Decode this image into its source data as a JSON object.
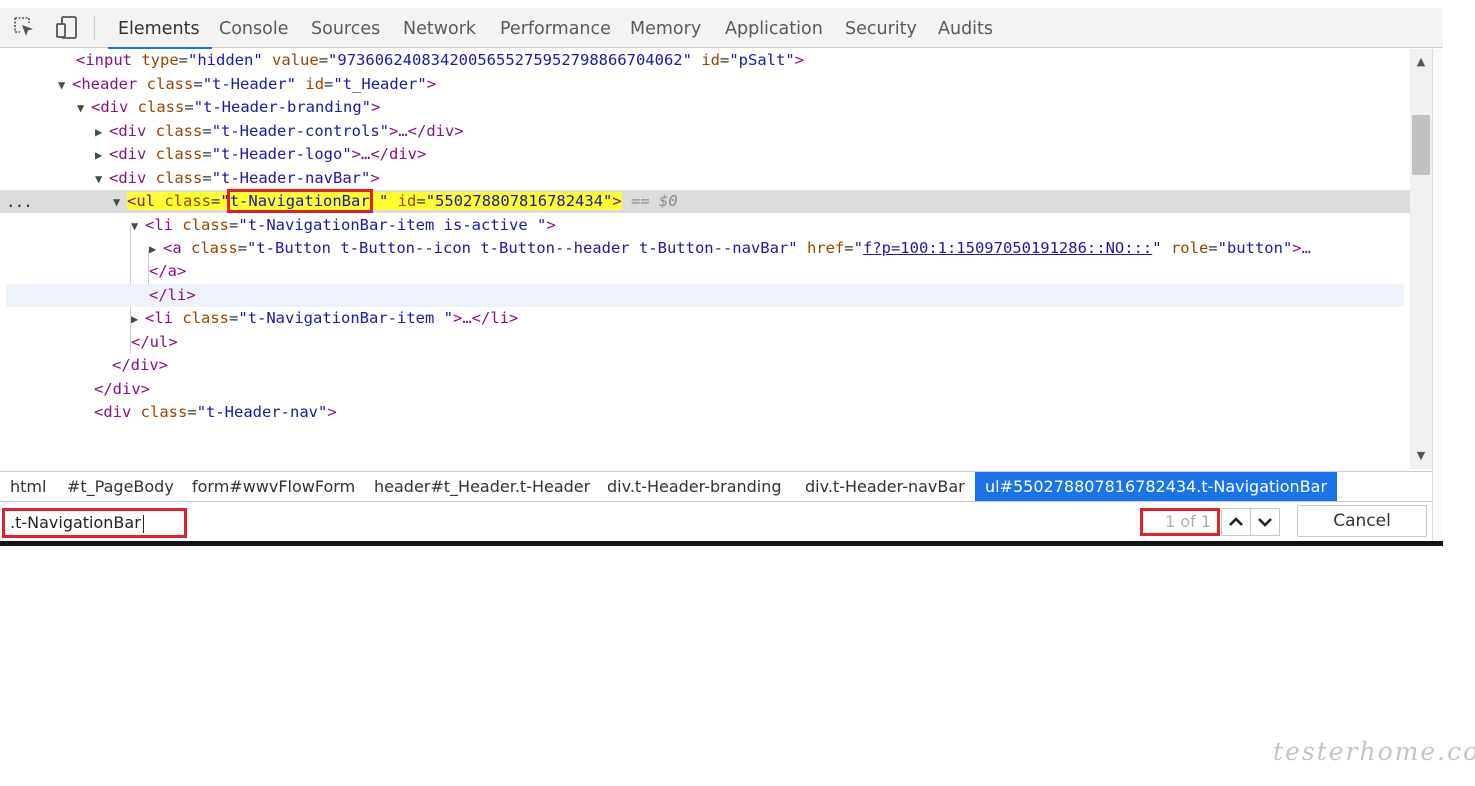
{
  "toolbar": {
    "icons": [
      "inspect-element-icon",
      "device-toolbar-icon"
    ],
    "tabs": [
      "Elements",
      "Console",
      "Sources",
      "Network",
      "Performance",
      "Memory",
      "Application",
      "Security",
      "Audits"
    ],
    "active_tab": "Elements"
  },
  "tree": {
    "r0": {
      "tag_open": "<input",
      "a1": "type",
      "v1": "\"hidden\"",
      "a2": "value",
      "v2": "\"97360624083420056552759527988667040​62\"",
      "a3": "id",
      "v3": "\"pSalt\"",
      "tag_close": ">"
    },
    "r1": {
      "tag_open": "<header",
      "a1": "class",
      "v1": "\"t-Header\"",
      "a2": "id",
      "v2": "\"t_Header\"",
      "tag_close": ">"
    },
    "r2": {
      "tag_open": "<div",
      "a1": "class",
      "v1": "\"t-Header-branding\"",
      "tag_close": ">"
    },
    "r3": {
      "tag_open": "<div",
      "a1": "class",
      "v1": "\"t-Header-controls\"",
      "tag_close": ">…</div>"
    },
    "r4": {
      "tag_open": "<div",
      "a1": "class",
      "v1": "\"t-Header-logo\"",
      "tag_close": ">…</div>"
    },
    "r5": {
      "tag_open": "<div",
      "a1": "class",
      "v1": "\"t-Header-navBar\"",
      "tag_close": ">"
    },
    "r6": {
      "tag_open": "<ul",
      "a1": "class",
      "q_open": "\"",
      "v1": "t-NavigationBar",
      "q_close": " \"",
      "a2": "id",
      "v2": "\"550278807816782434\"",
      "tag_close": ">",
      "suffix": "== $0",
      "dots": "..."
    },
    "r7": {
      "tag_open": "<li",
      "a1": "class",
      "v1": "\"t-NavigationBar-item is-active \"",
      "tag_close": ">"
    },
    "r8": {
      "tag_open": "<a",
      "a1": "class",
      "v1": "\"t-Button t-Button--icon t-Button--header t-Button--navBar\"",
      "a2": "href",
      "q_open": "\"",
      "link": "f?p=100:1:15097050191286::NO:::",
      "q_close": "\"",
      "a3": "role",
      "v3": "\"button\"",
      "tag_close": ">…"
    },
    "r9": {
      "tag_close": "</a>"
    },
    "r10": {
      "tag_close": "</li>"
    },
    "r11": {
      "tag_open": "<li",
      "a1": "class",
      "v1": "\"t-NavigationBar-item \"",
      "tag_close": ">…</li>"
    },
    "r12": {
      "tag_close": "</ul>"
    },
    "r13": {
      "tag_close": "</div>"
    },
    "r14": {
      "tag_close": "</div>"
    },
    "r15": {
      "tag_open": "<div",
      "a1": "class",
      "v1": "\"t-Header-nav\"",
      "tag_close": ">"
    }
  },
  "breadcrumbs": [
    "html",
    "#t_PageBody",
    "form#wwvFlowForm",
    "header#t_Header.t-Header",
    "div.t-Header-branding",
    "div.t-Header-navBar",
    "ul#550278807816782434.t-NavigationBar"
  ],
  "search": {
    "value": ".t-NavigationBar",
    "match_count": "1 of 1",
    "cancel_label": "Cancel"
  },
  "watermark": "testerhome.com",
  "colors": {
    "accent": "#1a73e8",
    "highlight": "#ffff30",
    "annotation_red": "#e0202a"
  }
}
